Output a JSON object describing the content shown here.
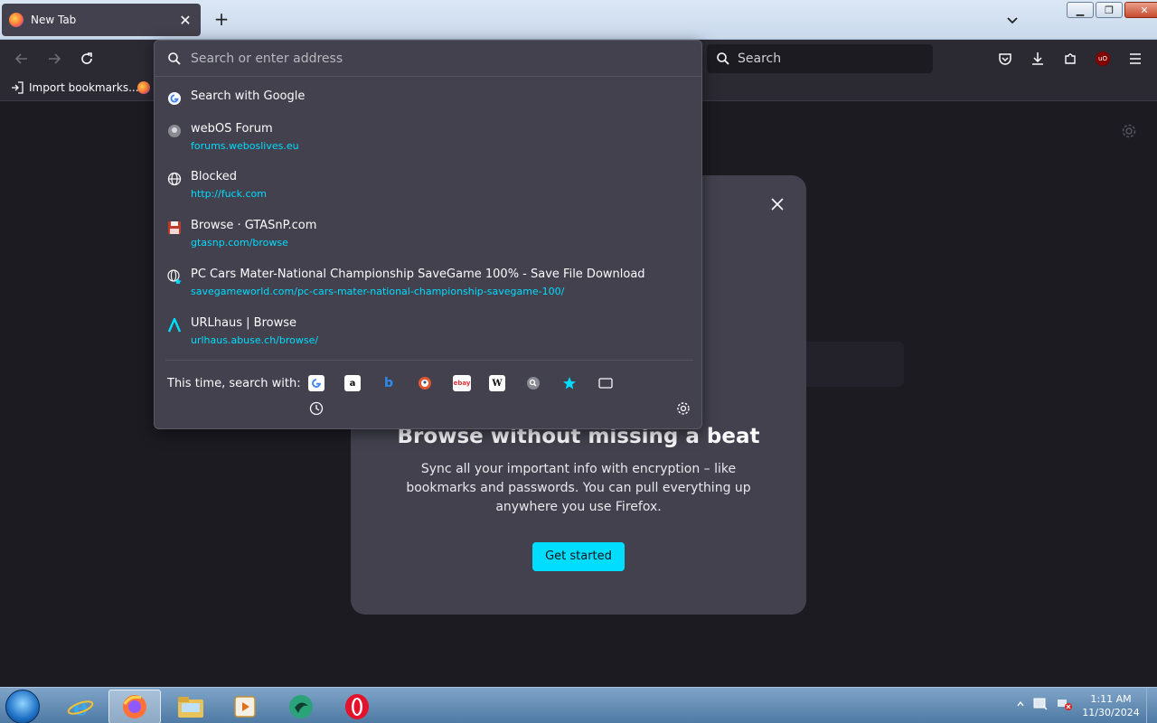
{
  "tab": {
    "title": "New Tab"
  },
  "toolbar": {
    "search_placeholder": "Search"
  },
  "bookmarks": {
    "import_label": "Import bookmarks..."
  },
  "urlbar": {
    "placeholder": "Search or enter address",
    "results": [
      {
        "title": "Search with Google",
        "url": "",
        "icon": "google-icon"
      },
      {
        "title": "webOS Forum",
        "url": "forums.weboslives.eu",
        "icon": "site-favicon-icon"
      },
      {
        "title": "Blocked",
        "url": "http://fuck.com",
        "icon": "globe-icon"
      },
      {
        "title": "Browse · GTASnP.com",
        "url": "gtasnp.com/browse",
        "icon": "floppy-disk-icon"
      },
      {
        "title": "PC Cars Mater-National Championship SaveGame 100% - Save File Download",
        "url": "savegameworld.com/pc-cars-mater-national-championship-savegame-100/",
        "icon": "globe-bookmark-icon"
      },
      {
        "title": "URLhaus | Browse",
        "url": "urlhaus.abuse.ch/browse/",
        "icon": "urlhaus-icon"
      }
    ],
    "one_time_label": "This time, search with:",
    "engines": [
      "google-icon",
      "amazon-icon",
      "bing-icon",
      "duckduckgo-icon",
      "ebay-icon",
      "wikipedia-icon",
      "search-engine-icon",
      "bookmarks-star-icon",
      "tabs-icon",
      "history-icon"
    ]
  },
  "card": {
    "title": "Browse without missing a beat",
    "body": "Sync all your important info with encryption – like bookmarks and passwords. You can pull everything up anywhere you use Firefox.",
    "cta": "Get started"
  },
  "taskbar": {
    "time": "1:11 AM",
    "date": "11/30/2024",
    "apps": [
      "internet-explorer-icon",
      "firefox-icon",
      "file-explorer-icon",
      "media-player-icon",
      "app-icon",
      "opera-icon"
    ]
  },
  "colors": {
    "accent": "#00ddff",
    "popup_bg": "#42414d",
    "page_bg": "#1c1b22"
  }
}
